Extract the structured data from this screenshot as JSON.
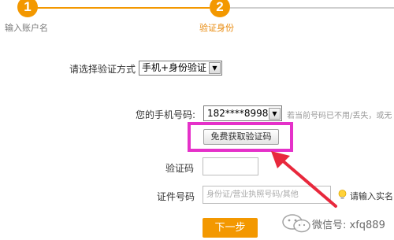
{
  "steps": [
    {
      "number": "1",
      "label": "输入账户名",
      "state": "done"
    },
    {
      "number": "2",
      "label": "验证身份",
      "state": "active"
    }
  ],
  "form": {
    "method_label": "请选择验证方式",
    "method_value": "手机+身份验证",
    "phone_label": "您的手机号码:",
    "phone_value": "182****8998",
    "phone_hint": "若当前号码已不用/丢失，或无",
    "get_code_button": "免费获取验证码",
    "code_label": "验证码",
    "code_value": "",
    "id_label": "证件号码",
    "id_placeholder": "身份证/营业执照号码/其他",
    "id_hint": "请输入实名",
    "next_button": "下一步"
  },
  "watermark": {
    "text": "微信号: xfq889"
  },
  "colors": {
    "accent": "#f39800",
    "highlight": "#e531c9",
    "arrow": "#e8283c"
  },
  "icons": [
    "dropdown-arrow-icon",
    "lightbulb-icon",
    "wechat-logo-icon",
    "red-arrow-icon"
  ]
}
